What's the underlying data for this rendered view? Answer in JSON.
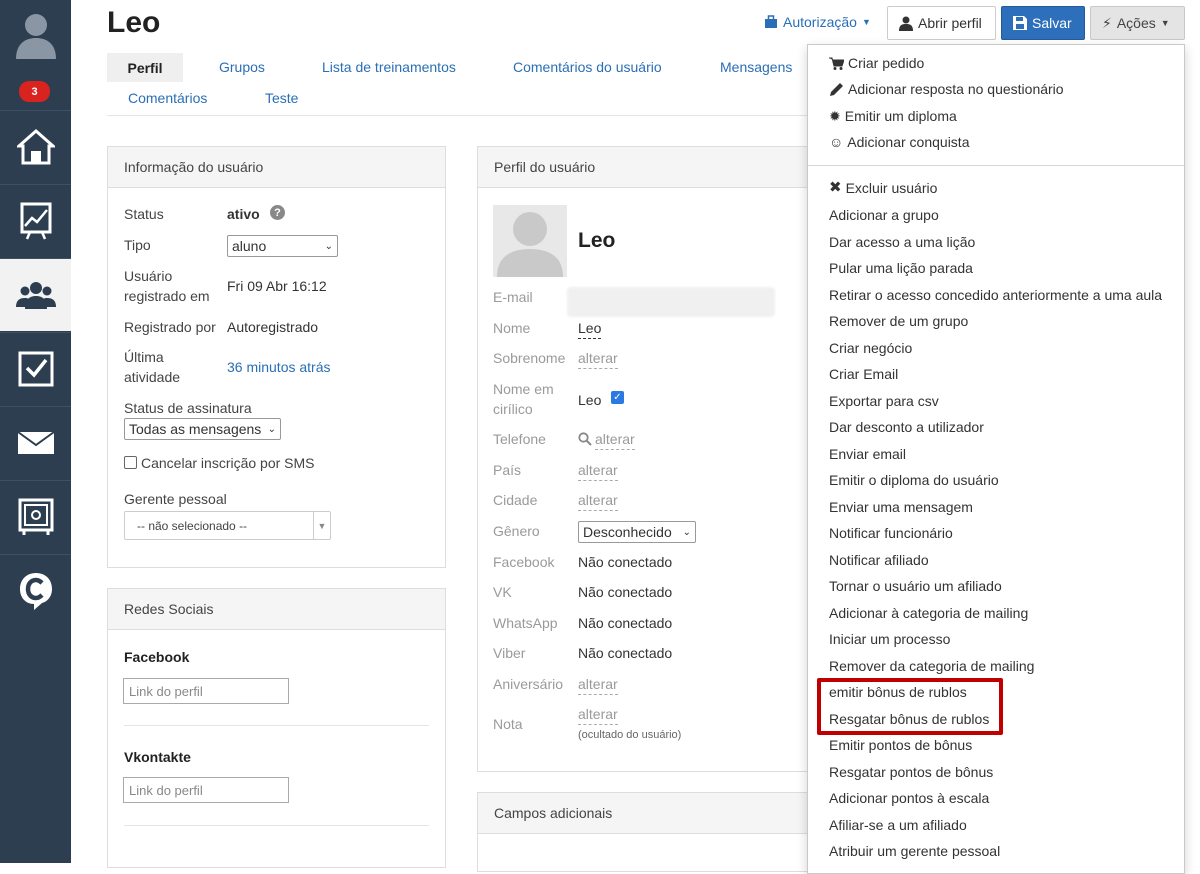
{
  "sidebar": {
    "badge": "3",
    "items": [
      "home-icon",
      "chart-icon",
      "users-icon",
      "checkbox-icon",
      "mail-icon",
      "safe-icon",
      "chat-logo-icon"
    ]
  },
  "header": {
    "title": "Leo",
    "auth_label": "Autorização",
    "open_profile_label": "Abrir perfil",
    "save_label": "Salvar",
    "actions_label": "Ações"
  },
  "tabs": {
    "active": "Perfil",
    "items": [
      "Grupos",
      "Lista de treinamentos",
      "Comentários do usuário",
      "Mensagens",
      "Comentários",
      "Teste"
    ]
  },
  "user_info": {
    "heading": "Informação do usuário",
    "status_label": "Status",
    "status_value": "ativo",
    "type_label": "Tipo",
    "type_value": "aluno",
    "registered_label_1": "Usuário",
    "registered_label_2": "registrado em",
    "registered_value": "Fri 09 Abr 16:12",
    "registered_by_label": "Registrado por",
    "registered_by_value": "Autoregistrado",
    "last_activity_label_1": "Última",
    "last_activity_label_2": "atividade",
    "last_activity_value": "36 minutos atrás",
    "subscription_label": "Status de assinatura",
    "subscription_value": "Todas as mensagens",
    "sms_label": "Cancelar inscrição por SMS",
    "manager_label": "Gerente pessoal",
    "manager_value": "-- não selecionado --"
  },
  "social": {
    "heading": "Redes Sociais",
    "facebook_label": "Facebook",
    "facebook_placeholder": "Link do perfil",
    "vk_label": "Vkontakte",
    "vk_placeholder": "Link do perfil"
  },
  "profile": {
    "heading": "Perfil do usuário",
    "name": "Leo",
    "email_label": "E-mail",
    "nome_label": "Nome",
    "nome_value": "Leo",
    "surname_label": "Sobrenome",
    "alter": "alterar",
    "cyrillic_label_1": "Nome em",
    "cyrillic_label_2": "cirílico",
    "cyrillic_value": "Leo",
    "phone_label": "Telefone",
    "country_label": "País",
    "city_label": "Cidade",
    "gender_label": "Gênero",
    "gender_value": "Desconhecido",
    "facebook_label": "Facebook",
    "vk_label": "VK",
    "whatsapp_label": "WhatsApp",
    "viber_label": "Viber",
    "not_connected": "Não conectado",
    "birthday_label": "Aniversário",
    "note_label": "Nota",
    "note_hint": "(ocultado do usuário)"
  },
  "extra_fields": {
    "heading": "Campos adicionais"
  },
  "actions_menu": {
    "group1": [
      "Criar pedido",
      "Adicionar resposta no questionário",
      "Emitir um diploma",
      "Adicionar conquista"
    ],
    "group2": [
      "Excluir usuário",
      "Adicionar a grupo",
      "Dar acesso a uma lição",
      "Pular uma lição parada",
      "Retirar o acesso concedido anteriormente a uma aula",
      "Remover de um grupo",
      "Criar negócio",
      "Criar Email",
      "Exportar para csv",
      "Dar desconto a utilizador",
      "Enviar email",
      "Emitir o diploma do usuário",
      "Enviar uma mensagem",
      "Notificar funcionário",
      "Notificar afiliado",
      "Tornar o usuário um afiliado",
      "Adicionar à categoria de mailing",
      "Iniciar um processo",
      "Remover da categoria de mailing",
      "emitir bônus de rublos",
      "Resgatar bônus de rublos",
      "Emitir pontos de bônus",
      "Resgatar pontos de bônus",
      "Adicionar pontos à escala",
      "Afiliar-se a um afiliado",
      "Atribuir um gerente pessoal"
    ]
  },
  "colors": {
    "sidebar": "#2c3e50",
    "link": "#2a6fb5",
    "save": "#2d6fba",
    "badge": "#d9231f",
    "highlight": "#c00000"
  }
}
